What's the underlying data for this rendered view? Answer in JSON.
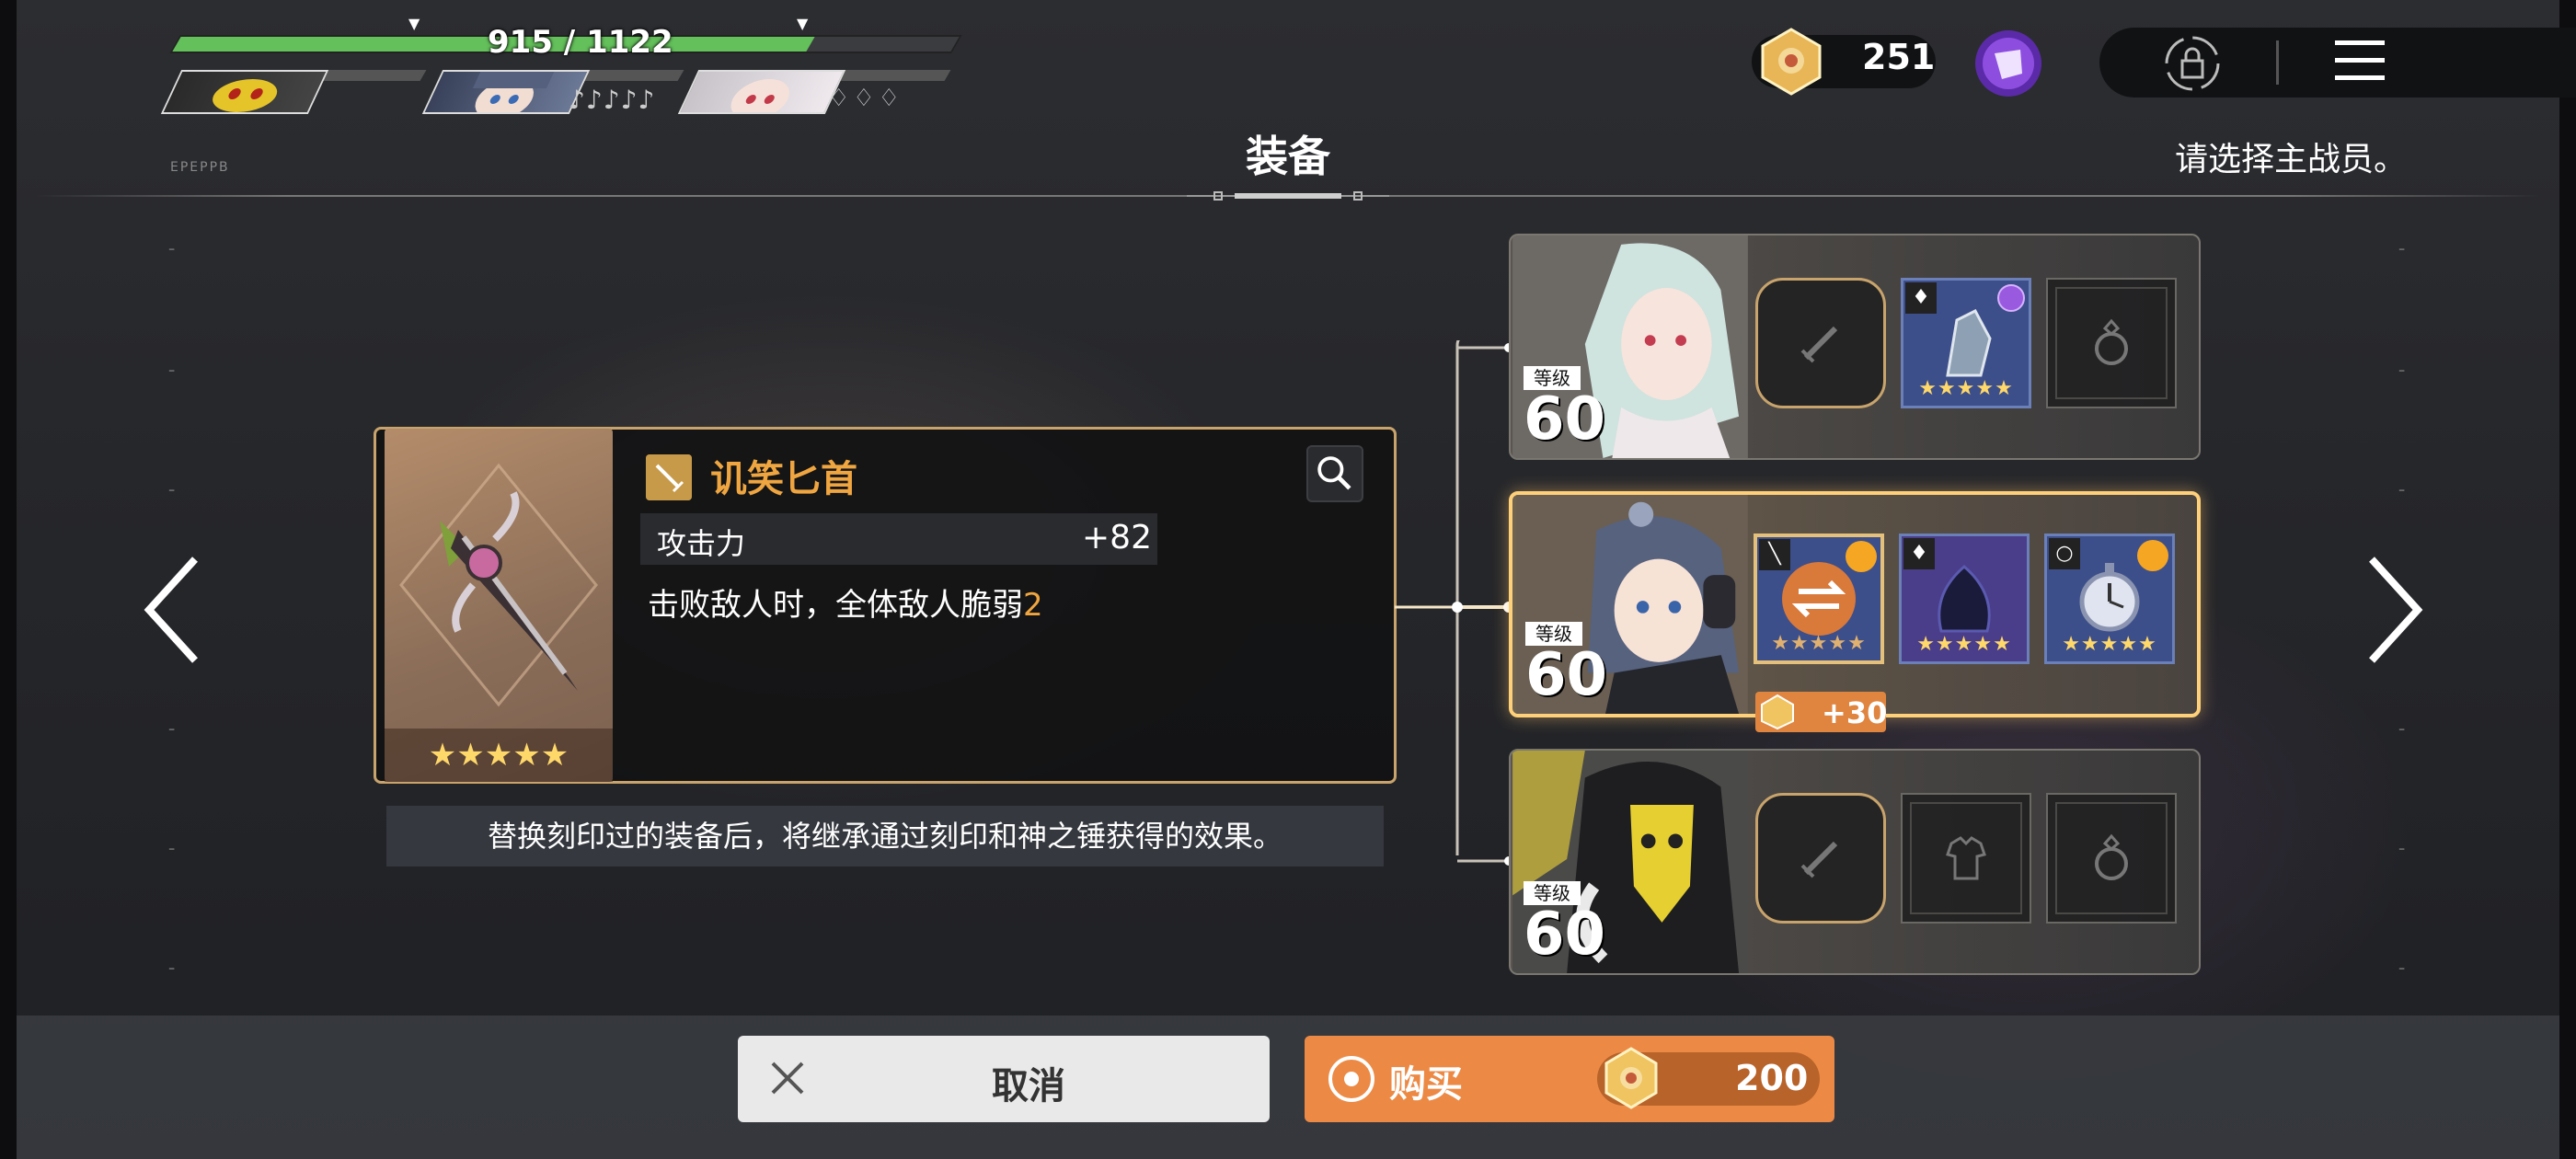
{
  "hud": {
    "hp_text": "915 / 1122",
    "hp_fraction": 0.815,
    "notes": "♪♪♪♪♪",
    "drops": "♢♢♢",
    "tiny_text": "EPEPPB",
    "currency_value": "251"
  },
  "header": {
    "title": "装备",
    "hint": "请选择主战员。"
  },
  "item": {
    "name": "讥笑匕首",
    "stars": "★★★★★",
    "stat_label": "攻击力",
    "stat_value": "+82",
    "effect_text": "击败敌人时，全体敌人脆弱",
    "effect_number": "2",
    "note": "替换刻印过的装备后，将继承通过刻印和神之锤获得的效果。"
  },
  "characters": [
    {
      "level_label": "等级",
      "level": "60",
      "slot_stars": "★★★★★"
    },
    {
      "level_label": "等级",
      "level": "60",
      "slot_stars": "★★★★★",
      "cost": "+30"
    },
    {
      "level_label": "等级",
      "level": "60"
    }
  ],
  "actions": {
    "cancel_label": "取消",
    "buy_label": "购买",
    "price": "200"
  },
  "colors": {
    "accent_orange": "#ec8a45",
    "item_name": "#f0a640",
    "hp_green": "#63c05a",
    "gold_border": "#c8a46c"
  }
}
